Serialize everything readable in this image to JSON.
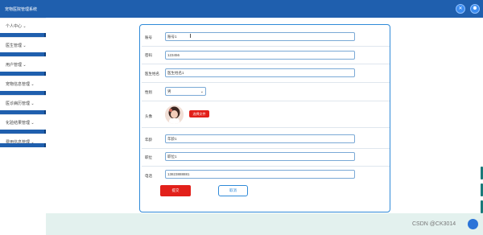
{
  "app": {
    "title": "宠物医院管理系统"
  },
  "header": {
    "icons": [
      "expand-icon",
      "user-icon"
    ]
  },
  "sidebar": {
    "items": [
      {
        "label": "个人中心",
        "arrow": "⌄"
      },
      {
        "label": "医生管理",
        "arrow": "⌄"
      },
      {
        "label": "用户管理",
        "arrow": "⌄"
      },
      {
        "label": "宠物信息管理",
        "arrow": "⌄"
      },
      {
        "label": "医诊病历管理",
        "arrow": "⌄"
      },
      {
        "label": "化验结果管理",
        "arrow": "⌄"
      },
      {
        "label": "费用信息管理",
        "arrow": "⌄"
      }
    ]
  },
  "form": {
    "fields": {
      "id": {
        "label": "账号",
        "value": "账号1"
      },
      "password": {
        "label": "密码",
        "value": "123456"
      },
      "doctor_name": {
        "label": "医生姓名",
        "value": "医生姓名1"
      },
      "gender": {
        "label": "性别",
        "value": "男"
      },
      "avatar": {
        "label": "头像",
        "upload_label": "选择文件"
      },
      "age": {
        "label": "年龄",
        "value": "年龄1"
      },
      "title": {
        "label": "职位",
        "value": "职位1"
      },
      "phone": {
        "label": "电话",
        "value": "13823888881"
      }
    },
    "submit_label": "提交",
    "cancel_label": "取消"
  },
  "watermark": "CSDN @CK3014"
}
